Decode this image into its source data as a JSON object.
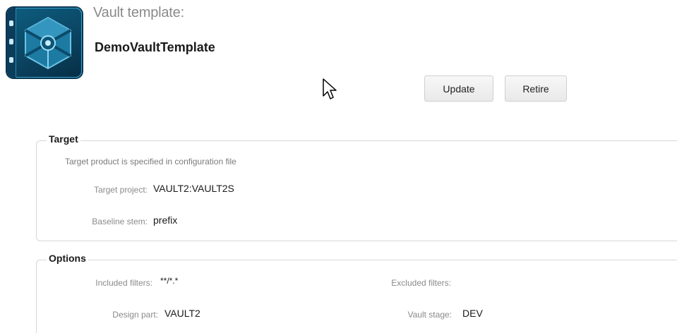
{
  "header": {
    "icon": "vault-template-icon",
    "label": "Vault template:",
    "name": "DemoVaultTemplate"
  },
  "actions": {
    "update_label": "Update",
    "retire_label": "Retire"
  },
  "target": {
    "legend": "Target",
    "note": "Target product is specified in configuration file",
    "project_label": "Target project:",
    "project_value": "VAULT2:VAULT2S",
    "baseline_label": "Baseline stem:",
    "baseline_value": "prefix"
  },
  "options": {
    "legend": "Options",
    "included_label": "Included filters:",
    "included_value": "**/*.*",
    "excluded_label": "Excluded filters:",
    "excluded_value": "",
    "design_part_label": "Design part:",
    "design_part_value": "VAULT2",
    "vault_stage_label": "Vault stage:",
    "vault_stage_value": "DEV"
  },
  "colors": {
    "icon_blue": "#0b4563",
    "label_gray": "#8a8a8a"
  }
}
